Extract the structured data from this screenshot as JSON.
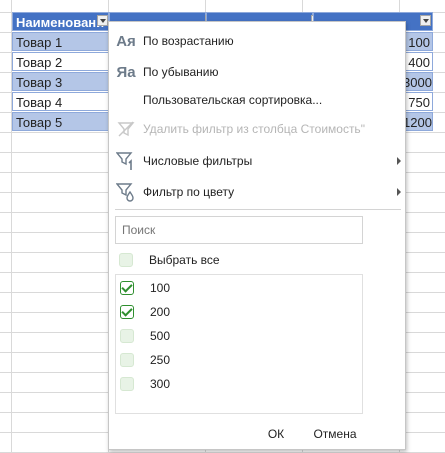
{
  "table": {
    "headers": [
      "Наименовани",
      "",
      "",
      ""
    ],
    "rows": [
      {
        "name": "Товар 1",
        "value": "100",
        "band": true
      },
      {
        "name": "Товар 2",
        "value": "400",
        "band": false
      },
      {
        "name": "Товар 3",
        "value": "3000",
        "band": true
      },
      {
        "name": "Товар 4",
        "value": "750",
        "band": false
      },
      {
        "name": "Товар 5",
        "value": "1200",
        "band": true
      }
    ]
  },
  "menu": {
    "sort_asc": {
      "icon": "Ая",
      "label": "По возрастанию"
    },
    "sort_desc": {
      "icon": "Яа",
      "label": "По убыванию"
    },
    "custom_sort": {
      "label": "Пользовательская сортировка..."
    },
    "clear_filter": {
      "label": "Удалить фильтр из столбца Стоимость\""
    },
    "number_filters": {
      "label": "Числовые фильтры"
    },
    "color_filter": {
      "label": "Фильтр по цвету"
    }
  },
  "search": {
    "placeholder": "Поиск"
  },
  "select_all": {
    "label": "Выбрать все",
    "checked": false
  },
  "values": [
    {
      "label": "100",
      "checked": true
    },
    {
      "label": "200",
      "checked": true
    },
    {
      "label": "500",
      "checked": false
    },
    {
      "label": "250",
      "checked": false
    },
    {
      "label": "300",
      "checked": false
    }
  ],
  "buttons": {
    "ok": "ОК",
    "cancel": "Отмена"
  },
  "colors": {
    "header": "#4472c4",
    "band": "#b4c6e7",
    "check": "#2f8f2f"
  }
}
